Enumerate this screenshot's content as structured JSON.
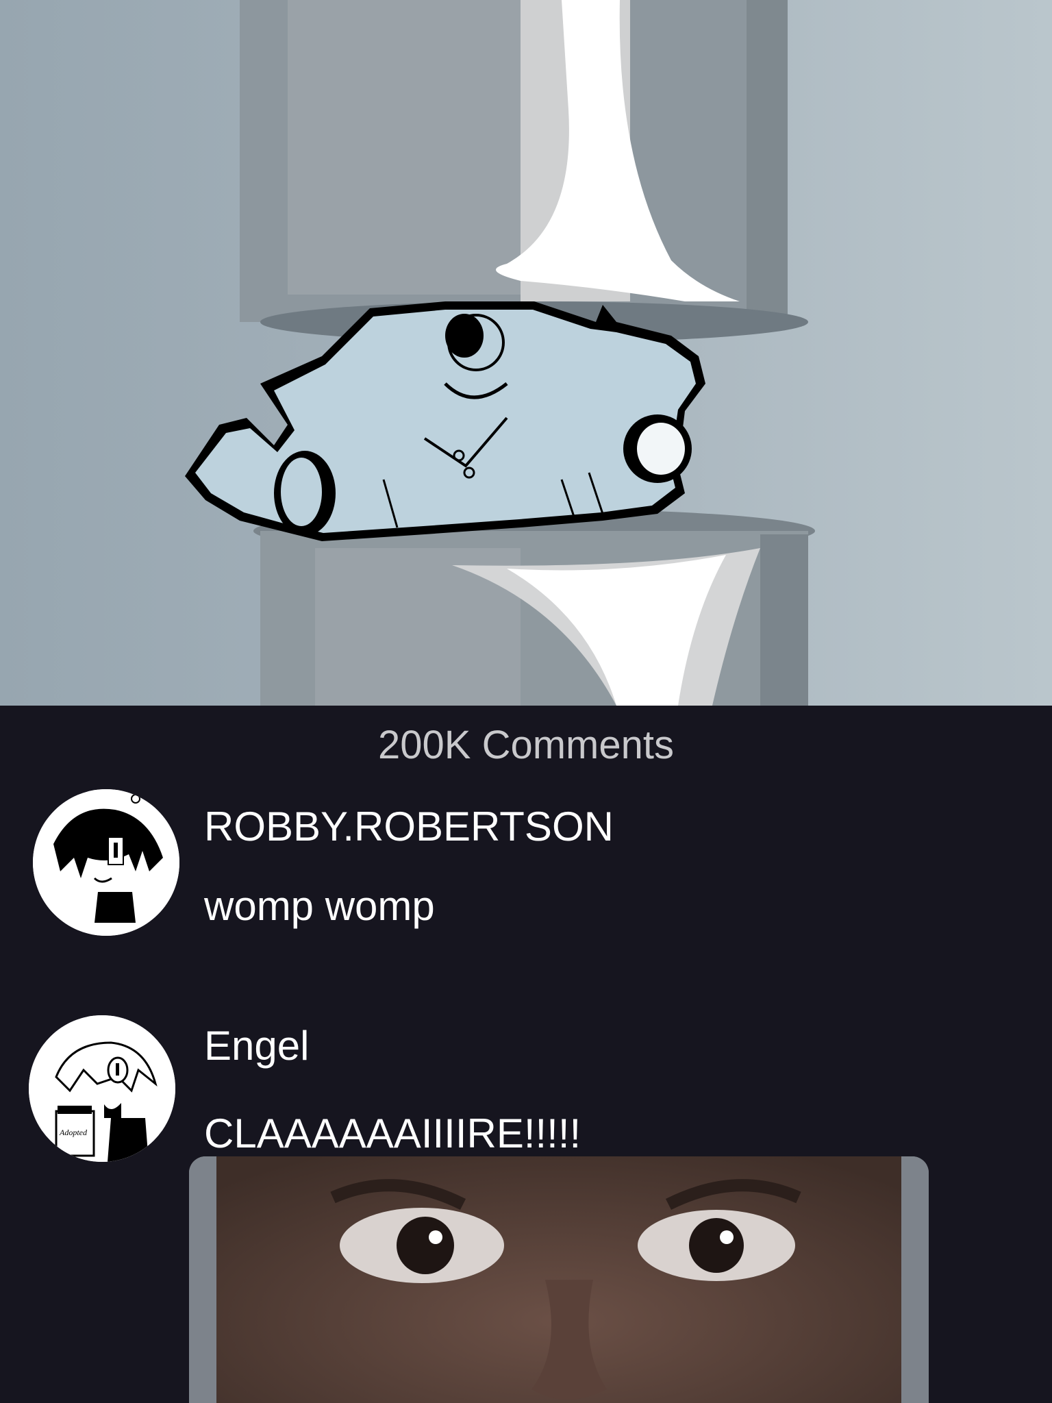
{
  "comments_header": {
    "count_label": "200K Comments"
  },
  "comments": [
    {
      "username": "ROBBY.ROBERTSON",
      "text": "womp womp"
    },
    {
      "username": "Engel",
      "text": "CLAAAAAAIIIIRE!!!!!",
      "avatar_jar_label": "Adopted"
    }
  ],
  "colors": {
    "panel_background": "#16151f",
    "count_text": "#c9c9cc",
    "comment_text": "#ffffff",
    "illustration_background": "#a8b5be"
  }
}
